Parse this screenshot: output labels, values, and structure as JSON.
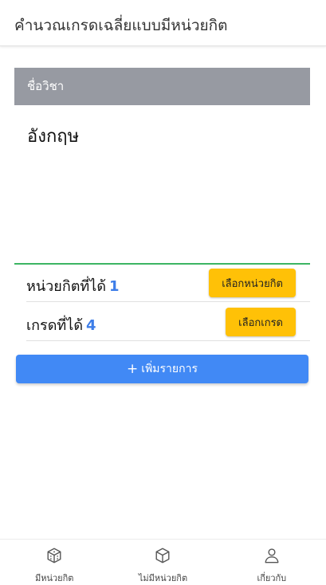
{
  "appbar": {
    "title": "คำนวณเกรดเฉลี่ยแบบมีหน่วยกิต"
  },
  "subject": {
    "header": "ชื่อวิชา",
    "name": "อังกฤษ"
  },
  "credit": {
    "label": "หน่วยกิตที่ได้",
    "value": "1",
    "button": "เลือกหน่วยกิต"
  },
  "grade": {
    "label": "เกรดที่ได้",
    "value": "4",
    "button": "เลือกเกรด"
  },
  "add_button": {
    "icon": "plus-icon",
    "label": "เพิ่มรายการ"
  },
  "bottom_nav": {
    "items": [
      {
        "label": "มีหน่วยกิต",
        "icon": "dice-icon"
      },
      {
        "label": "ไม่มีหน่วยกิต",
        "icon": "cube-icon"
      },
      {
        "label": "เกี่ยวกับ",
        "icon": "person-icon"
      }
    ]
  },
  "colors": {
    "accent_blue": "#4189f5",
    "button_yellow": "#ffc107",
    "header_gray": "#979aa2",
    "divider_green": "#3cb563",
    "value_blue": "#3d7de8"
  }
}
